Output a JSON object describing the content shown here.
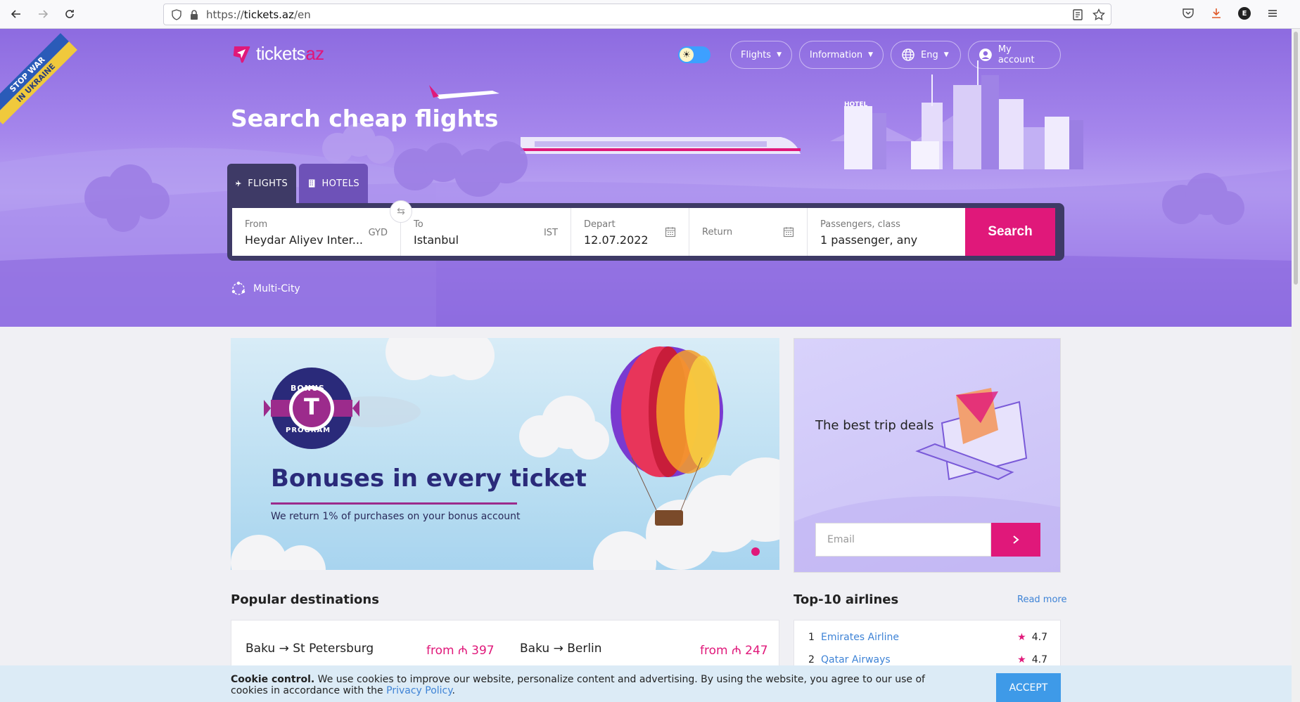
{
  "browser": {
    "url_scheme": "https://",
    "url_host": "tickets.az",
    "url_path": "/en",
    "profile_initial": "E"
  },
  "ribbon": {
    "line1": "STOP WAR",
    "line2": "IN UKRAINE"
  },
  "logo": {
    "main": "tickets",
    "accent": "az"
  },
  "nav": {
    "flights": "Flights",
    "information": "Information",
    "language": "Eng",
    "account": "My account"
  },
  "hero": {
    "title": "Search cheap flights",
    "hotel_sign": "HOTEL"
  },
  "tabs": {
    "flights": "FLIGHTS",
    "hotels": "HOTELS"
  },
  "search": {
    "from_label": "From",
    "from_value": "Heydar Aliyev Inter...",
    "from_code": "GYD",
    "to_label": "To",
    "to_value": "Istanbul",
    "to_code": "IST",
    "depart_label": "Depart",
    "depart_value": "12.07.2022",
    "return_label": "Return",
    "passengers_label": "Passengers, class",
    "passengers_value": "1 passenger, any",
    "button": "Search"
  },
  "multi_city": "Multi-City",
  "banner": {
    "badge_top": "BONUS",
    "badge_letter": "T",
    "badge_bottom": "PROGRAM",
    "title": "Bonuses in every ticket",
    "subtitle": "We return 1% of purchases on your bonus account"
  },
  "deals": {
    "title": "The best trip deals",
    "email_placeholder": "Email"
  },
  "popular": {
    "title": "Popular destinations",
    "routes": [
      {
        "route": "Baku → St Petersburg",
        "price": "from ₼ 397"
      },
      {
        "route": "Baku → Berlin",
        "price": "from ₼ 247"
      }
    ]
  },
  "airlines": {
    "title": "Top-10 airlines",
    "read_more": "Read more",
    "items": [
      {
        "rank": "1",
        "name": "Emirates Airline",
        "rating": "4.7"
      },
      {
        "rank": "2",
        "name": "Qatar Airways",
        "rating": "4.7"
      }
    ]
  },
  "cookie": {
    "bold": "Cookie control.",
    "text": " We use cookies to improve our website, personalize content and advertising. By using the website, you agree to our use of cookies in accordance with the ",
    "link": "Privacy Policy",
    "end": ".",
    "accept": "ACCEPT"
  },
  "colors": {
    "brand_pink": "#e0187a",
    "hero_purple": "#9a78e6",
    "form_dark": "#3e3a66",
    "link_blue": "#3e83d6"
  }
}
